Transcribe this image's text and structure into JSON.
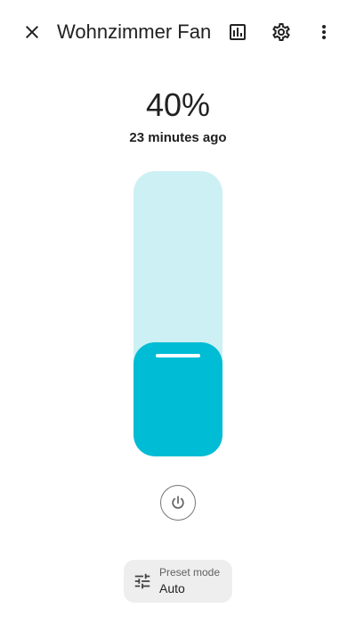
{
  "header": {
    "title": "Wohnzimmer Fan",
    "icons": {
      "close": "close-icon",
      "history": "chart-box-icon",
      "settings": "gear-icon",
      "more": "dots-vertical-icon"
    }
  },
  "entity": {
    "state": "40%",
    "last_changed": "23 minutes ago",
    "percentage": 40
  },
  "power": {
    "icon": "power-icon"
  },
  "preset": {
    "label": "Preset mode",
    "value": "Auto",
    "icon": "tune-icon"
  },
  "colors": {
    "accent": "#00bcd4",
    "track": "#cdf0f4",
    "chip": "#eeeeee"
  }
}
